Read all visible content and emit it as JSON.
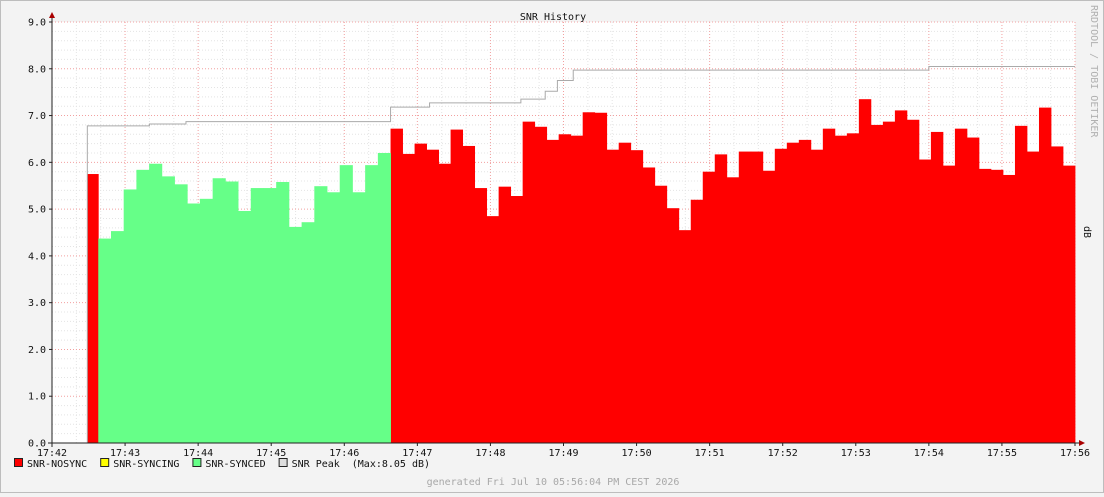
{
  "chart_data": {
    "type": "area",
    "title": "SNR History",
    "ylabel": "dB",
    "ylim": [
      0,
      9
    ],
    "xlim": [
      "17:42",
      "17:56"
    ],
    "yticks": [
      "0.0",
      "1.0",
      "2.0",
      "3.0",
      "4.0",
      "5.0",
      "6.0",
      "7.0",
      "8.0",
      "9.0"
    ],
    "xticks": [
      "17:42",
      "17:43",
      "17:44",
      "17:45",
      "17:46",
      "17:47",
      "17:48",
      "17:49",
      "17:50",
      "17:51",
      "17:52",
      "17:53",
      "17:54",
      "17:55",
      "17:56"
    ],
    "grid": true,
    "legend_position": "bottom-left",
    "watermark": "RRDTOOL / TOBI OETIKER",
    "footer": "generated Fri Jul 10 05:56:04 PM CEST 2026",
    "colors": {
      "SNR-NOSYNC": "#ff0000",
      "SNR-SYNCING": "#ffff00",
      "SNR-SYNCED": "#66ff88",
      "SNR Peak": "#aaaaaa",
      "background": "#ffffff",
      "canvas_bg": "#f3f3f3"
    },
    "legend": [
      {
        "name": "SNR-NOSYNC",
        "color": "#ff0000",
        "suffix": ""
      },
      {
        "name": "SNR-SYNCING",
        "color": "#ffff00",
        "suffix": ""
      },
      {
        "name": "SNR-SYNCED",
        "color": "#66ff88",
        "suffix": ""
      },
      {
        "name": "SNR Peak",
        "color": "#dddddd",
        "suffix": "(Max:8.05 dB)"
      }
    ],
    "series": [
      {
        "name": "SNR-NOSYNC",
        "type": "area",
        "color": "#ff0000",
        "points": [
          {
            "x": "17:42:29",
            "x2": "17:42:38",
            "y": 5.75
          },
          {
            "x": "17:46:38",
            "x2": "17:56:00",
            "y": [
              6.72,
              6.18,
              6.4,
              6.27,
              5.97,
              6.7,
              6.35,
              5.45,
              4.85,
              5.48,
              5.28,
              6.87,
              6.76,
              6.48,
              6.6,
              6.57,
              7.07,
              7.06,
              6.27,
              6.42,
              6.26,
              5.89,
              5.5,
              5.02,
              4.55,
              5.2,
              5.8,
              6.17,
              5.68,
              6.23,
              6.23,
              5.82,
              6.29,
              6.42,
              6.48,
              6.27,
              6.72,
              6.57,
              6.62,
              7.35,
              6.8,
              6.87,
              7.11,
              6.91,
              6.06,
              6.65,
              5.93,
              6.72,
              6.53,
              5.86,
              5.84,
              5.73,
              6.78,
              6.23,
              7.17,
              6.34,
              5.93
            ]
          }
        ]
      },
      {
        "name": "SNR-SYNCED",
        "type": "area",
        "color": "#66ff88",
        "points": [
          {
            "x": "17:42:38",
            "x2": "17:46:38",
            "y": [
              4.37,
              4.53,
              5.42,
              5.84,
              5.97,
              5.7,
              5.53,
              5.12,
              5.22,
              5.66,
              5.59,
              4.96,
              5.45,
              5.45,
              5.58,
              4.62,
              4.72,
              5.49,
              5.36,
              5.94,
              5.36,
              5.94,
              6.2
            ]
          }
        ]
      },
      {
        "name": "SNR Peak",
        "type": "step",
        "color": "#aaaaaa",
        "points": [
          {
            "x": "17:42:29",
            "y": 6.78
          },
          {
            "x": "17:43:20",
            "y": 6.82
          },
          {
            "x": "17:43:50",
            "y": 6.87
          },
          {
            "x": "17:46:38",
            "y": 7.18
          },
          {
            "x": "17:47:10",
            "y": 7.27
          },
          {
            "x": "17:48:25",
            "y": 7.35
          },
          {
            "x": "17:48:45",
            "y": 7.52
          },
          {
            "x": "17:48:55",
            "y": 7.75
          },
          {
            "x": "17:49:08",
            "y": 7.97
          },
          {
            "x": "17:54:00",
            "y": 8.05
          }
        ]
      }
    ]
  }
}
